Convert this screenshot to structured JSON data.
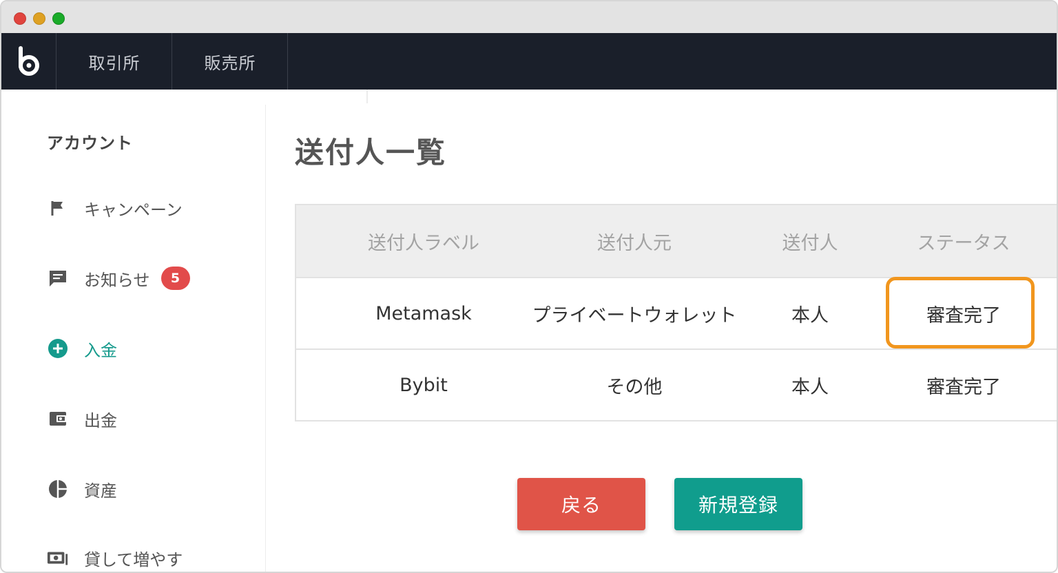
{
  "navbar": {
    "tabs": [
      {
        "label": "取引所"
      },
      {
        "label": "販売所"
      }
    ]
  },
  "sidebar": {
    "heading": "アカウント",
    "items": [
      {
        "label": "キャンペーン",
        "icon": "flag-icon"
      },
      {
        "label": "お知らせ",
        "icon": "message-icon",
        "badge": "5"
      },
      {
        "label": "入金",
        "icon": "plus-circle-icon",
        "active": true
      },
      {
        "label": "出金",
        "icon": "wallet-icon"
      },
      {
        "label": "資産",
        "icon": "pie-chart-icon"
      },
      {
        "label": "貸して増やす",
        "icon": "money-icon"
      }
    ]
  },
  "main": {
    "title": "送付人一覧",
    "table": {
      "headers": [
        "送付人ラベル",
        "送付人元",
        "送付人",
        "ステータス"
      ],
      "rows": [
        [
          "Metamask",
          "プライベートウォレット",
          "本人",
          "審査完了"
        ],
        [
          "Bybit",
          "その他",
          "本人",
          "審査完了"
        ]
      ]
    },
    "buttons": {
      "back": "戻る",
      "new": "新規登録"
    }
  },
  "colors": {
    "navbar": "#1a1f2a",
    "active": "#159a8c",
    "badge": "#e24b4b",
    "highlight": "#f1961e",
    "back_button": "#e05448",
    "new_button": "#109d8d"
  }
}
